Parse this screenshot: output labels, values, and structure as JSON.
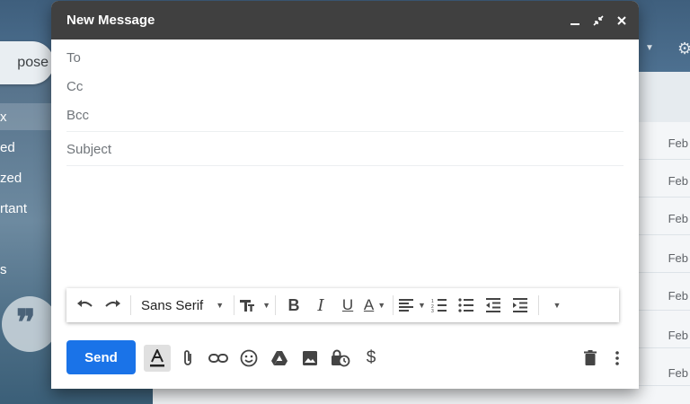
{
  "background": {
    "compose_button": "pose",
    "sidebar_items": [
      "x",
      "ed",
      "zed",
      "rtant",
      "s"
    ],
    "row_dates": [
      "Feb",
      "Feb",
      "Feb",
      "Feb",
      "Feb",
      "Feb",
      "Feb"
    ]
  },
  "compose": {
    "title": "New Message",
    "fields": {
      "to": "To",
      "cc": "Cc",
      "bcc": "Bcc",
      "subject": "Subject"
    },
    "toolbar": {
      "font": "Sans Serif"
    },
    "send_label": "Send"
  },
  "colors": {
    "header": "#404040",
    "send": "#1a73e8"
  }
}
